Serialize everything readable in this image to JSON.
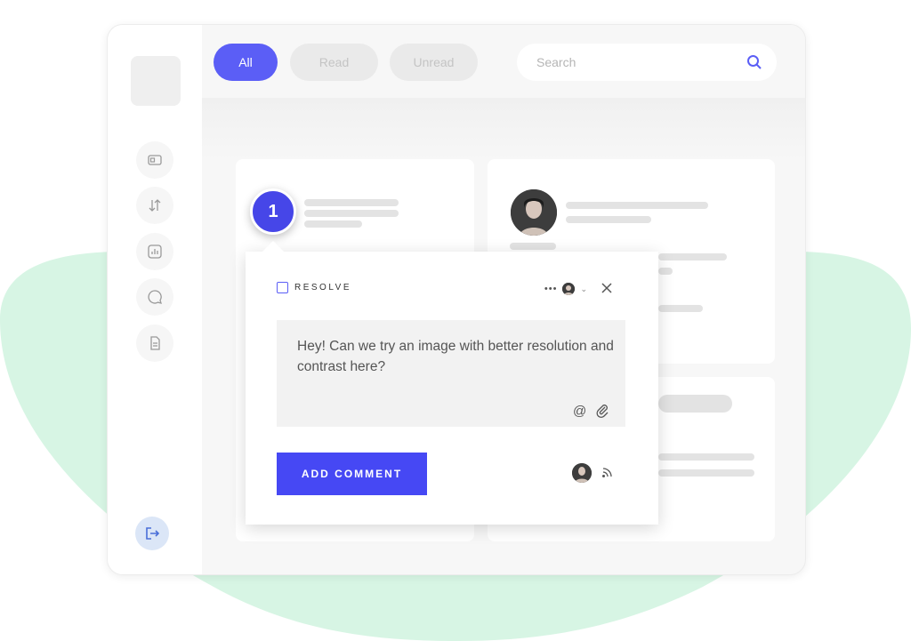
{
  "filters": {
    "all_label": "All",
    "read_label": "Read",
    "unread_label": "Unread",
    "active": "All"
  },
  "search": {
    "placeholder": "Search"
  },
  "comment_popup": {
    "badge_number": "1",
    "resolve_label": "RESOLVE",
    "menu_dots": "•••",
    "comment_text": "Hey! Can we try an image with better resolution and contrast here?",
    "add_button_label": "ADD COMMENT"
  },
  "sidebar": {
    "icons": [
      "id-card-icon",
      "sort-arrows-icon",
      "chart-icon",
      "chat-bubble-icon",
      "document-icon"
    ],
    "logout_icon": "logout-icon"
  },
  "colors": {
    "accent": "#5b5ef6",
    "button": "#4648f4",
    "badge": "#4646e8",
    "background_blob": "#d7f5e4"
  }
}
